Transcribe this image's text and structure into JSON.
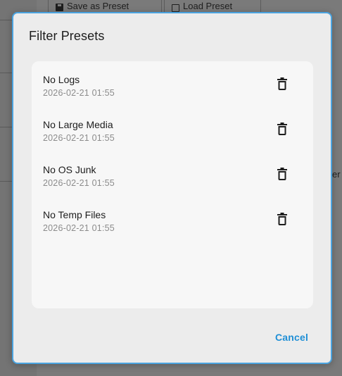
{
  "background": {
    "toolbar": {
      "save_preset_label": "Save as Preset",
      "load_preset_label": "Load Preset"
    },
    "right_edge_text": "er"
  },
  "dialog": {
    "title": "Filter Presets",
    "presets": [
      {
        "name": "No Logs",
        "date": "2026-02-21 01:55"
      },
      {
        "name": "No Large Media",
        "date": "2026-02-21 01:55"
      },
      {
        "name": "No OS Junk",
        "date": "2026-02-21 01:55"
      },
      {
        "name": "No Temp Files",
        "date": "2026-02-21 01:55"
      }
    ],
    "cancel_label": "Cancel"
  },
  "colors": {
    "accent": "#1f8fd6",
    "dialog_border": "#4aa3df",
    "dialog_bg": "#ececec",
    "list_bg": "#f7f7f7"
  },
  "icons": {
    "delete": "trash-icon",
    "save": "save-icon",
    "load": "folder-icon"
  }
}
